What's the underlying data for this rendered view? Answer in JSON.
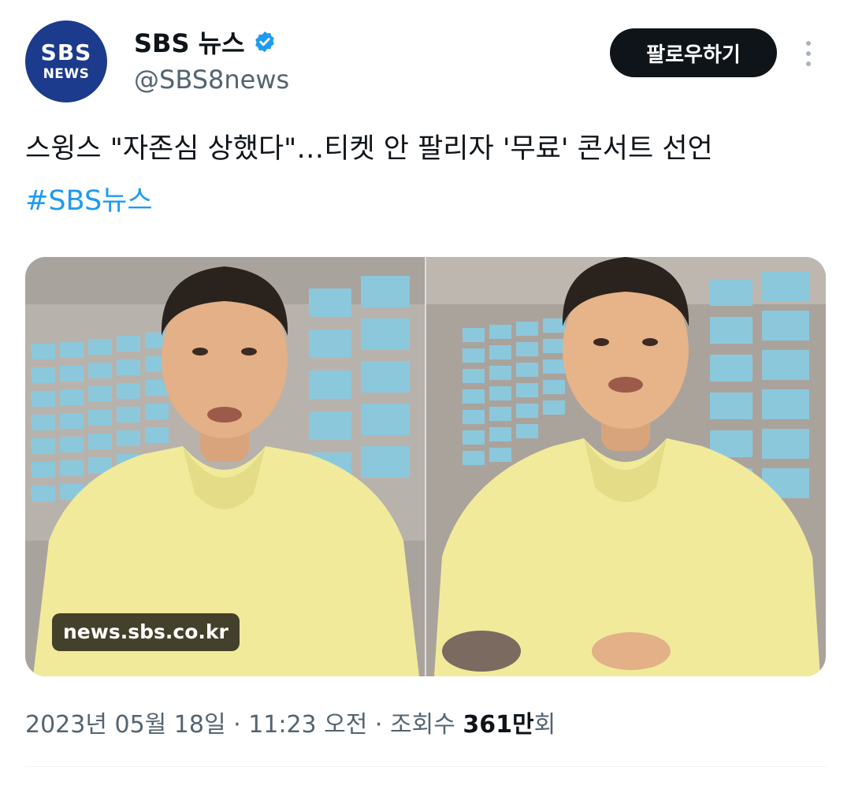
{
  "account": {
    "avatar_line1": "SBS",
    "avatar_line2": "NEWS",
    "display_name": "SBS 뉴스",
    "handle": "@SBS8news",
    "verified_icon": "verified-badge-icon",
    "follow_label": "팔로우하기",
    "more_icon": "more-vertical-icon"
  },
  "tweet": {
    "text": "스윙스 \"자존심 상했다\"…티켓 안 팔리자 '무료' 콘서트 선언",
    "hashtag": "#SBS뉴스"
  },
  "media": {
    "source_label": "news.sbs.co.kr",
    "images": [
      {
        "description": "person-in-yellow-polo-left"
      },
      {
        "description": "person-in-yellow-polo-right"
      }
    ]
  },
  "meta": {
    "date": "2023년 05월 18일",
    "sep1": " · ",
    "time": "11:23 오전",
    "sep2": " · ",
    "views_label": "조회수 ",
    "views_count": "361만",
    "views_suffix": "회"
  },
  "colors": {
    "accent": "#1d9bf0",
    "text_primary": "#0f1419",
    "text_secondary": "#536471",
    "avatar_bg": "#1c3b8c",
    "shirt": "#f1ea9a"
  }
}
